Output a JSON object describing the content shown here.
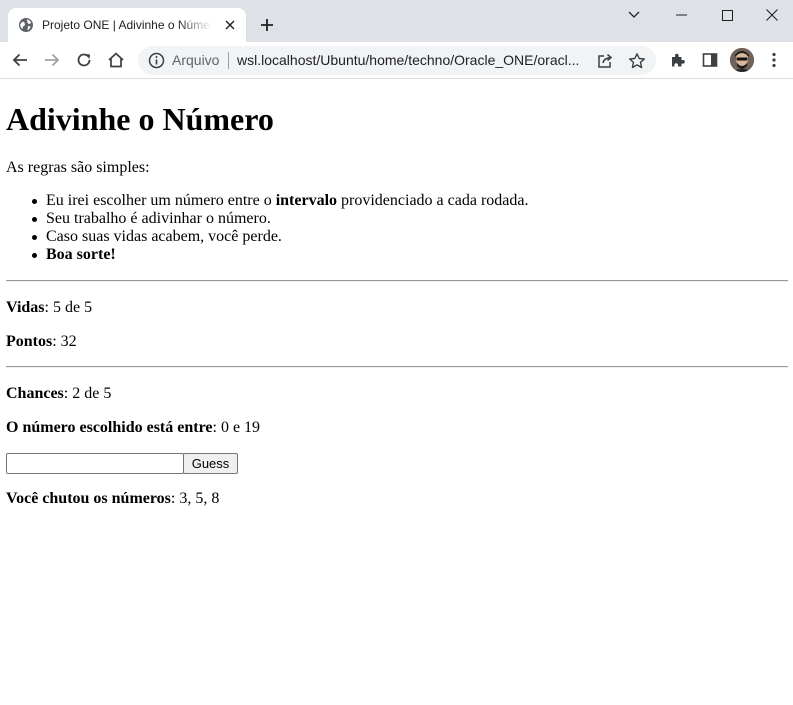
{
  "browser": {
    "tab_title": "Projeto ONE | Adivinhe o Número",
    "scheme_label": "Arquivo",
    "url": "wsl.localhost/Ubuntu/home/techno/Oracle_ONE/oracl..."
  },
  "page": {
    "heading": "Adivinhe o Número",
    "intro": "As regras são simples:",
    "rules": [
      {
        "before": "Eu irei escolher um número entre o ",
        "bold": "intervalo",
        "after": " providenciado a cada rodada."
      },
      {
        "before": "Seu trabalho é adivinhar o número.",
        "bold": "",
        "after": ""
      },
      {
        "before": "Caso suas vidas acabem, você perde.",
        "bold": "",
        "after": ""
      },
      {
        "before": "",
        "bold": "Boa sorte!",
        "after": ""
      }
    ],
    "lives": {
      "label": "Vidas",
      "value": ": 5 de 5"
    },
    "points": {
      "label": "Pontos",
      "value": ": 32"
    },
    "chances": {
      "label": "Chances",
      "value": ": 2 de 5"
    },
    "range": {
      "label": "O número escolhido está entre",
      "value": ": 0 e 19"
    },
    "guess": {
      "input_value": "",
      "button_label": "Guess"
    },
    "guessed": {
      "label": "Você chutou os números",
      "value": ": 3, 5, 8"
    }
  }
}
